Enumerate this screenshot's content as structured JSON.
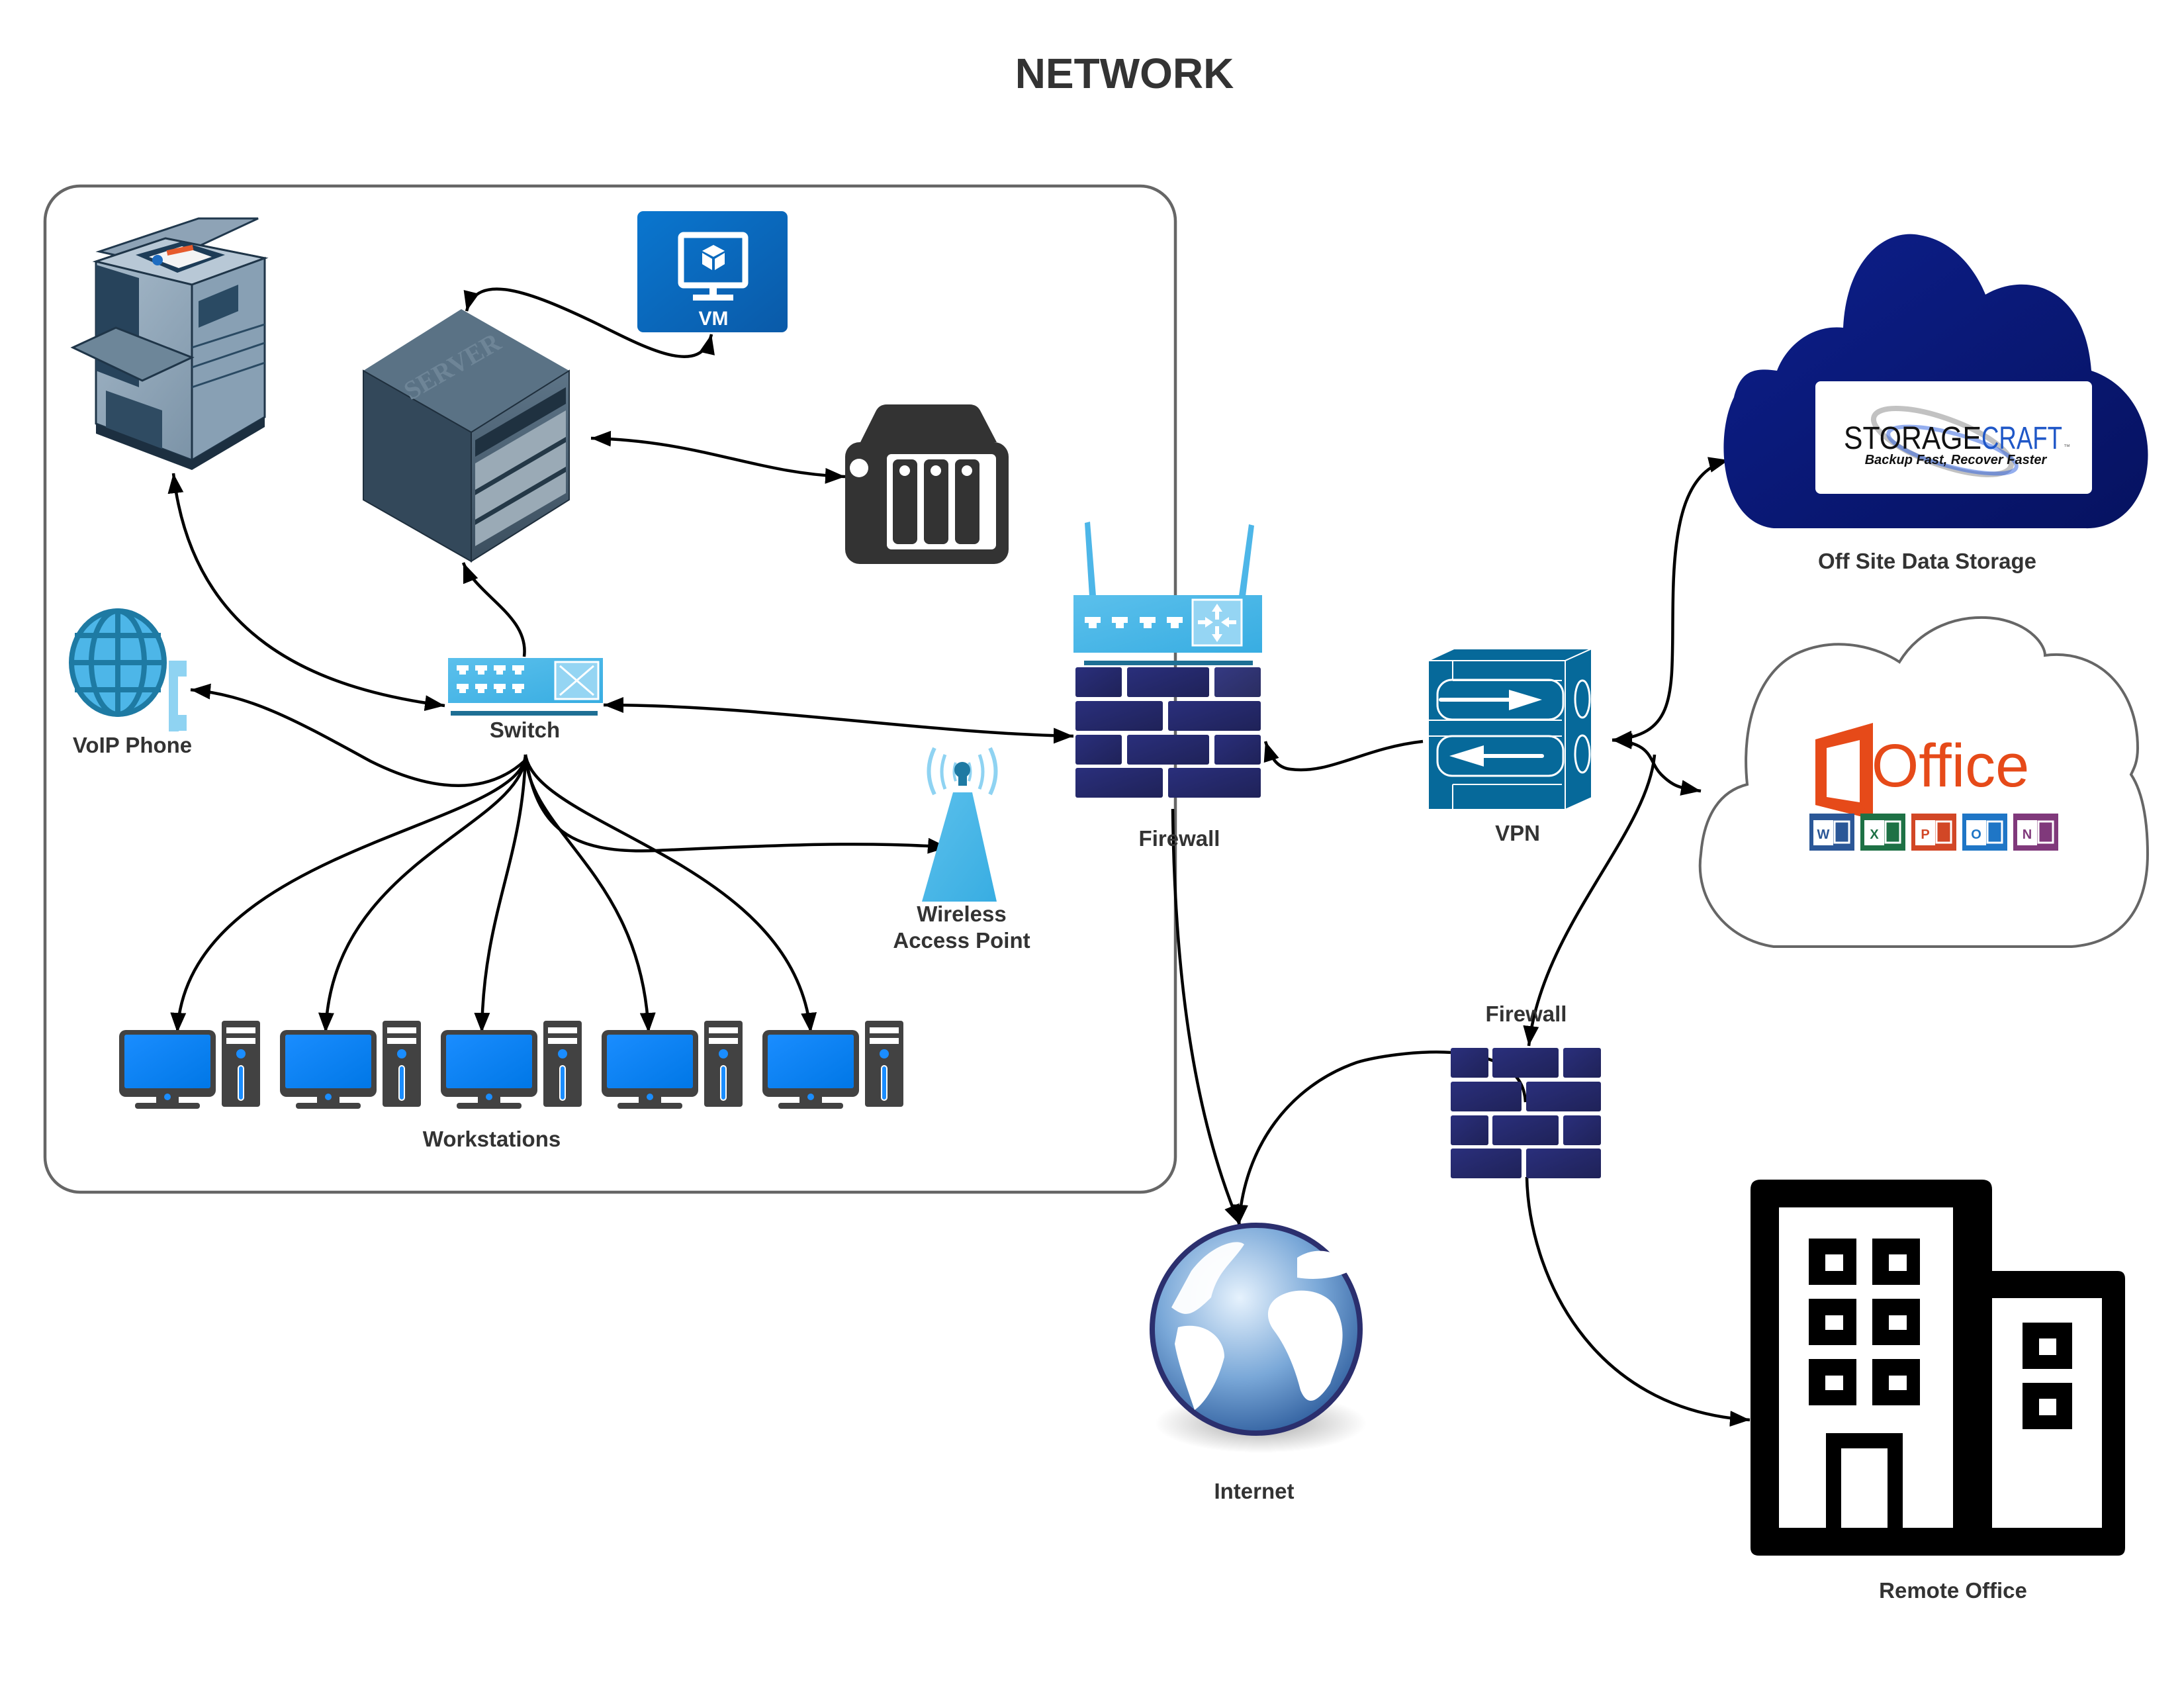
{
  "title": "NETWORK",
  "container": {
    "name": "local-network-group"
  },
  "nodes": {
    "printer": {
      "label": "",
      "icon": "printer-copier-icon"
    },
    "vm": {
      "label": "VM",
      "icon": "virtual-machine-icon",
      "color": "#0a6fc2"
    },
    "server": {
      "label": "",
      "icon": "server-icon",
      "engraved_text": "SERVER"
    },
    "nas": {
      "label": "",
      "icon": "nas-storage-icon",
      "color": "#333333"
    },
    "voip": {
      "label": "VoIP Phone",
      "icon": "voip-phone-icon",
      "color": "#3aa6dd"
    },
    "switch": {
      "label": "Switch",
      "icon": "switch-icon",
      "color": "#49b6e6"
    },
    "wap": {
      "label_line1": "Wireless",
      "label_line2": "Access Point",
      "icon": "wireless-access-point-icon"
    },
    "router": {
      "label": "Router",
      "icon": "router-icon",
      "color": "#49b6e6"
    },
    "firewall_main": {
      "label": "Firewall",
      "icon": "firewall-icon",
      "color": "#262b70"
    },
    "vpn": {
      "label": "VPN",
      "icon": "vpn-icon",
      "color": "#06699a"
    },
    "offsite": {
      "label": "Off Site Data Storage",
      "icon": "cloud-icon",
      "color": "#0b1a7a",
      "logo_word1": "STORAGE",
      "logo_word2": "CRAFT",
      "logo_tm": "™",
      "logo_tagline": "Backup Fast, Recover Faster"
    },
    "office365": {
      "label": "",
      "icon": "cloud-outline-icon",
      "logo_text": "Office",
      "logo_color": "#e64a19",
      "apps": [
        {
          "letter": "W",
          "name": "word",
          "color": "#2b5797"
        },
        {
          "letter": "X",
          "name": "excel",
          "color": "#1e7145"
        },
        {
          "letter": "P",
          "name": "powerpoint",
          "color": "#d24726"
        },
        {
          "letter": "O",
          "name": "outlook",
          "color": "#1f76c6"
        },
        {
          "letter": "N",
          "name": "onenote",
          "color": "#80397b"
        }
      ]
    },
    "firewall_remote": {
      "label": "Firewall",
      "icon": "firewall-icon"
    },
    "internet": {
      "label": "Internet",
      "icon": "globe-icon"
    },
    "remote_office": {
      "label": "Remote Office",
      "icon": "office-building-icon"
    },
    "workstations": {
      "label": "Workstations",
      "count": 5,
      "icon": "workstation-icon"
    }
  },
  "edges": [
    {
      "from": "switch",
      "to": "printer",
      "direction": "both"
    },
    {
      "from": "switch",
      "to": "server",
      "direction": "to"
    },
    {
      "from": "server",
      "to": "vm",
      "direction": "both"
    },
    {
      "from": "server",
      "to": "nas",
      "direction": "both"
    },
    {
      "from": "switch",
      "to": "voip",
      "direction": "to"
    },
    {
      "from": "switch",
      "to": "firewall_main",
      "direction": "both"
    },
    {
      "from": "switch",
      "to": "wap",
      "direction": "to"
    },
    {
      "from": "switch",
      "to": "workstation-1",
      "direction": "to"
    },
    {
      "from": "switch",
      "to": "workstation-2",
      "direction": "to"
    },
    {
      "from": "switch",
      "to": "workstation-3",
      "direction": "to"
    },
    {
      "from": "switch",
      "to": "workstation-4",
      "direction": "to"
    },
    {
      "from": "switch",
      "to": "workstation-5",
      "direction": "to"
    },
    {
      "from": "vpn",
      "to": "firewall_main",
      "direction": "to"
    },
    {
      "from": "firewall_main",
      "to": "internet",
      "direction": "to"
    },
    {
      "from": "vpn",
      "to": "offsite",
      "direction": "both"
    },
    {
      "from": "vpn",
      "to": "office365",
      "direction": "both"
    },
    {
      "from": "vpn",
      "to": "firewall_remote",
      "direction": "to"
    },
    {
      "from": "firewall_remote",
      "to": "internet",
      "direction": "to"
    },
    {
      "from": "firewall_remote",
      "to": "remote_office",
      "direction": "to"
    }
  ]
}
